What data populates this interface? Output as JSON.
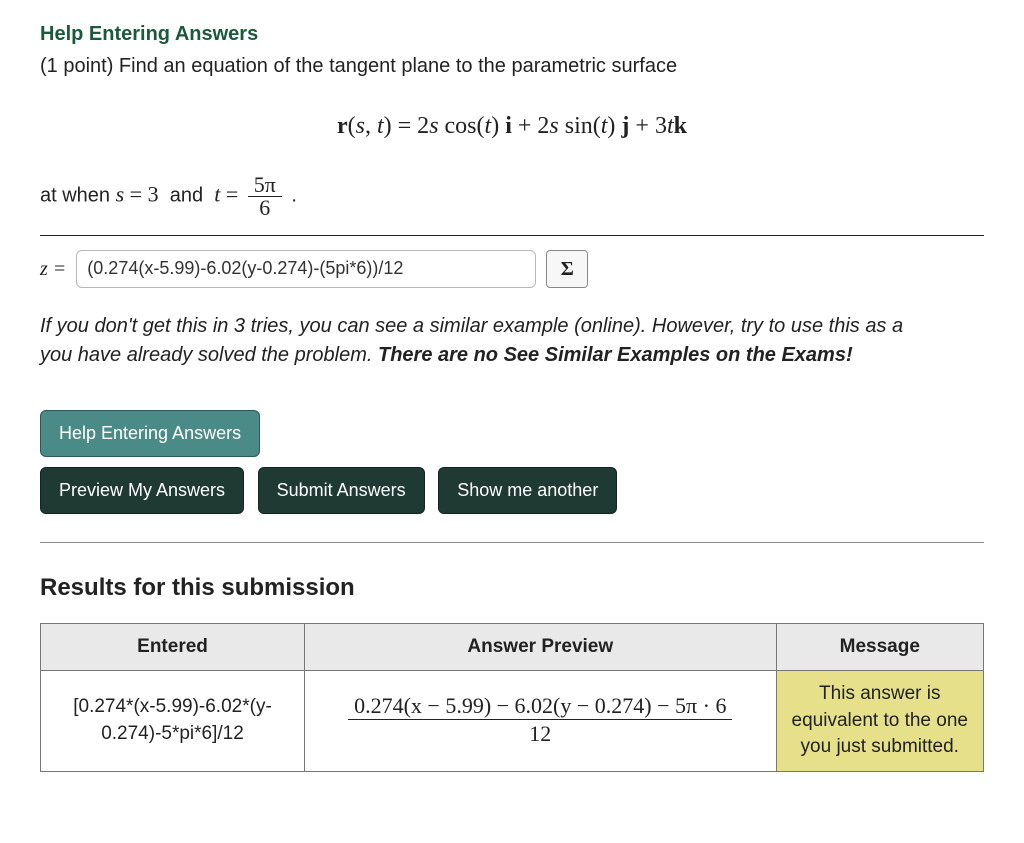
{
  "help_link": "Help Entering Answers",
  "prompt_prefix": "(1 point) Find an equation of the tangent plane to the parametric surface",
  "equation": {
    "lhs": "r(s, t)",
    "rhs_plain": "2s cos(t) i + 2s sin(t) j + 3t k"
  },
  "param": {
    "lead": "at when ",
    "s_eq": "s = 3",
    "and": " and ",
    "t_eq_lead": "t = ",
    "frac_num": "5π",
    "frac_den": "6",
    "tail": " ."
  },
  "answer": {
    "label": "z =",
    "value": "(0.274(x-5.99)-6.02(y-0.274)-(5pi*6))/12",
    "sigma": "Σ"
  },
  "hint": {
    "line1": "If you don't get this in 3 tries, you can see a similar example (online). However, try to use this as a",
    "line2_plain": "you have already solved the problem. ",
    "line2_bold": "There are no See Similar Examples on the Exams!"
  },
  "buttons": {
    "help": "Help Entering Answers",
    "preview": "Preview My Answers",
    "submit": "Submit Answers",
    "another": "Show me another"
  },
  "results": {
    "heading": "Results for this submission",
    "headers": {
      "entered": "Entered",
      "preview": "Answer Preview",
      "message": "Message"
    },
    "row": {
      "entered": "[0.274*(x-5.99)-6.02*(y-0.274)-5*pi*6]/12",
      "preview_num": "0.274(x − 5.99) − 6.02(y − 0.274) − 5π · 6",
      "preview_den": "12",
      "message": "This answer is equivalent to the one you just submitted."
    }
  }
}
